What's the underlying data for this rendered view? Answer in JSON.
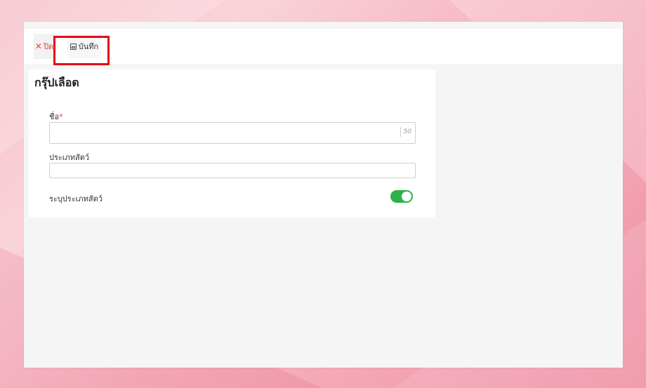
{
  "toolbar": {
    "close_label": "ปิด",
    "save_label": "บันทึก"
  },
  "form": {
    "title": "กรุ๊ปเลือด",
    "name_label": "ชื่อ",
    "name_required_mark": "*",
    "name_value": "",
    "name_max_length": "50",
    "animal_type_label": "ประเภทสัตว์",
    "animal_type_value": "",
    "specify_animal_type_label": "ระบุประเภทสัตว์",
    "specify_animal_type_enabled": true
  },
  "colors": {
    "accent_toggle": "#2db14a",
    "close_red": "#e04a3a",
    "highlight_red": "#e8001c"
  }
}
